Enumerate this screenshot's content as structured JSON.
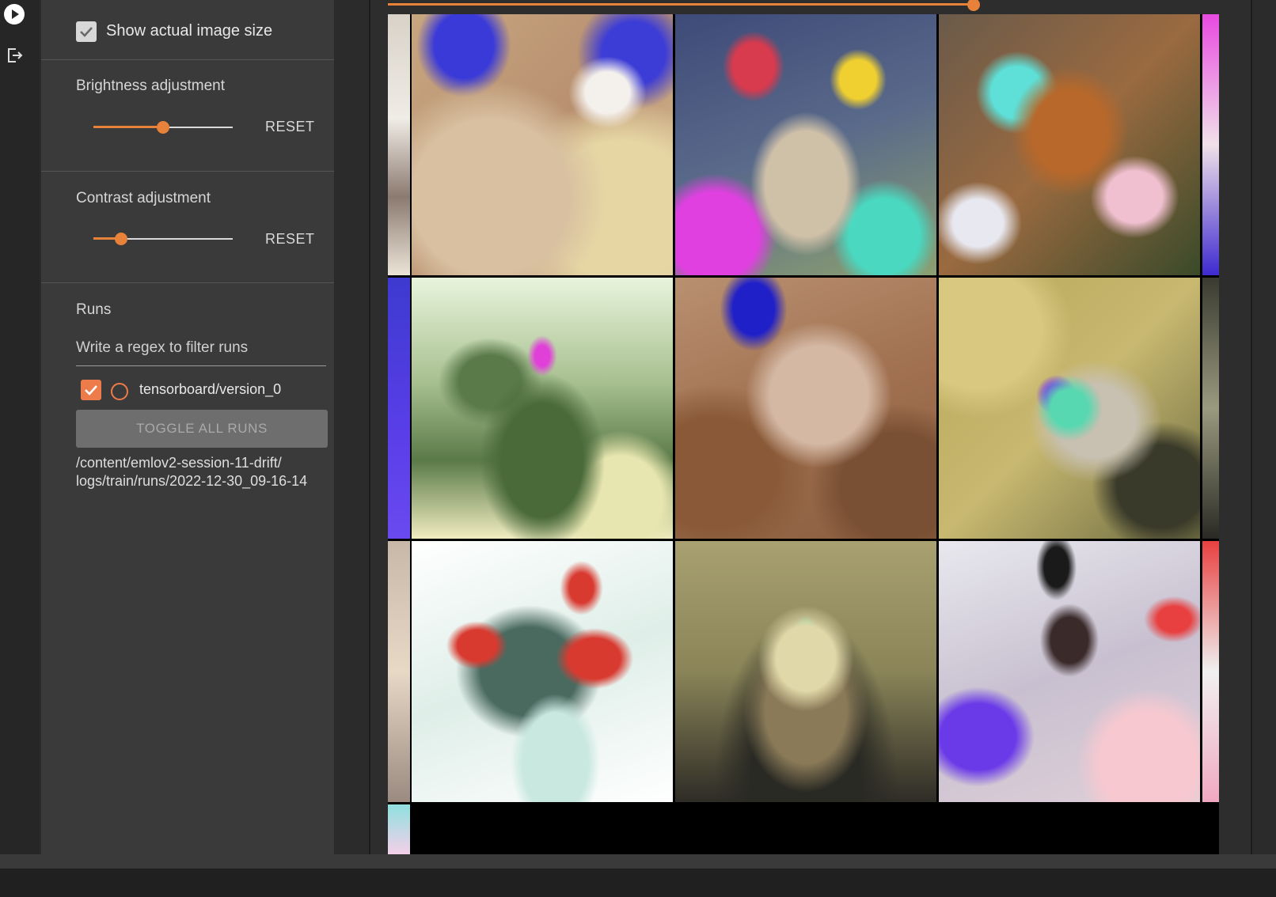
{
  "settings": {
    "show_actual_size_label": "Show actual image size",
    "show_actual_size_checked": true
  },
  "brightness": {
    "title": "Brightness adjustment",
    "reset_label": "RESET",
    "level": 0.5
  },
  "contrast": {
    "title": "Contrast adjustment",
    "reset_label": "RESET",
    "level": 0.2
  },
  "runs": {
    "title": "Runs",
    "filter_placeholder": "Write a regex to filter runs",
    "items": [
      {
        "label": "tensorboard/version_0",
        "checked": true
      }
    ],
    "toggle_all_label": "TOGGLE ALL RUNS",
    "path": "/content/emlov2-session-11-drift/\nlogs/train/runs/2022-12-30_09-16-14"
  },
  "accent_color": "#e8823a",
  "step_level": 0.96,
  "icons": [
    "play-circle-icon",
    "export-icon",
    "checkmark-icon",
    "circle-outline-icon"
  ]
}
